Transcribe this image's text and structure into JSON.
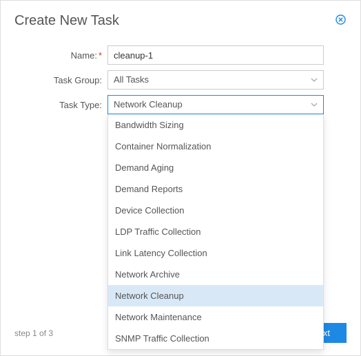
{
  "dialog": {
    "title": "Create New Task"
  },
  "form": {
    "name_label": "Name:",
    "name_value": "cleanup-1",
    "group_label": "Task Group:",
    "group_value": "All Tasks",
    "type_label": "Task Type:",
    "type_value": "Network Cleanup",
    "type_options": [
      "Bandwidth Sizing",
      "Container Normalization",
      "Demand Aging",
      "Demand Reports",
      "Device Collection",
      "LDP Traffic Collection",
      "Link Latency Collection",
      "Network Archive",
      "Network Cleanup",
      "Network Maintenance",
      "SNMP Traffic Collection"
    ]
  },
  "footer": {
    "step_text": "step 1 of 3",
    "next_label": "Next"
  },
  "colors": {
    "accent": "#1e88e5",
    "required": "#d93025"
  }
}
